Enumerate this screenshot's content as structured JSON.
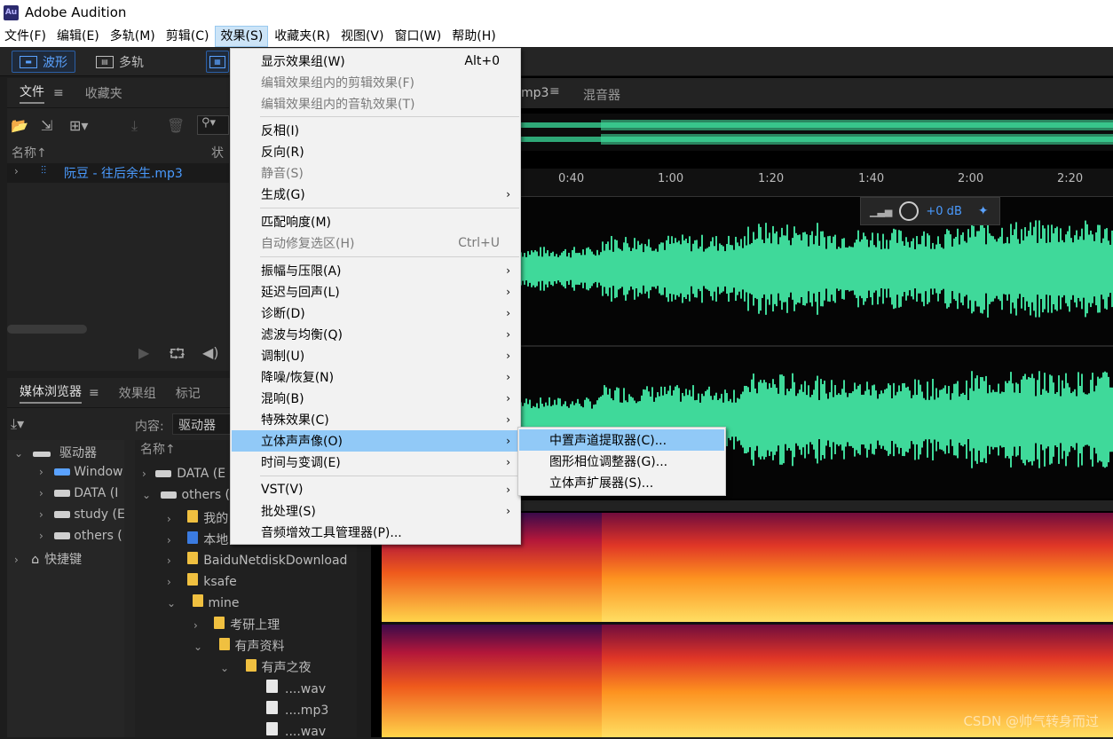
{
  "app": {
    "logo": "Au",
    "title": "Adobe Audition"
  },
  "menubar": [
    "文件(F)",
    "编辑(E)",
    "多轨(M)",
    "剪辑(C)",
    "效果(S)",
    "收藏夹(R)",
    "视图(V)",
    "窗口(W)",
    "帮助(H)"
  ],
  "toolbar": {
    "waveform": "波形",
    "multitrack": "多轨"
  },
  "files_panel": {
    "tabs": [
      "文件",
      "收藏夹"
    ],
    "col_name": "名称",
    "col_status": "状",
    "file": "阮豆 - 往后余生.mp3"
  },
  "media_panel": {
    "tabs": [
      "媒体浏览器",
      "效果组",
      "标记"
    ],
    "content_label": "内容:",
    "content_value": "驱动器",
    "col_name": "名称",
    "left_tree": [
      {
        "label": "驱动器"
      },
      {
        "label": "Window"
      },
      {
        "label": "DATA (I"
      },
      {
        "label": "study (E"
      },
      {
        "label": "others ("
      },
      {
        "label": "快捷键"
      }
    ],
    "right_tree": [
      {
        "label": "DATA (E"
      },
      {
        "label": "others ("
      },
      {
        "label": "我的"
      },
      {
        "label": "本地"
      },
      {
        "label": "BaiduNetdiskDownload"
      },
      {
        "label": "ksafe"
      },
      {
        "label": "mine"
      },
      {
        "label": "考研上理"
      },
      {
        "label": "有声资料"
      },
      {
        "label": "有声之夜"
      },
      {
        "label": "....wav"
      },
      {
        "label": "....mp3"
      },
      {
        "label": "....wav"
      }
    ]
  },
  "editor": {
    "tab_suffix": "mp3",
    "mixer_tab": "混音器",
    "ruler": [
      "0:40",
      "1:00",
      "1:20",
      "1:40",
      "2:00",
      "2:20"
    ],
    "hud_db": "+0 dB"
  },
  "effects_menu": {
    "items": [
      {
        "label": "显示效果组(W)",
        "shortcut": "Alt+0",
        "disabled": false
      },
      {
        "label": "编辑效果组内的剪辑效果(F)",
        "disabled": true
      },
      {
        "label": "编辑效果组内的音轨效果(T)",
        "disabled": true
      },
      {
        "label": "反相(I)"
      },
      {
        "label": "反向(R)"
      },
      {
        "label": "静音(S)",
        "disabled": true
      },
      {
        "label": "生成(G)",
        "submenu": true
      },
      {
        "label": "匹配响度(M)"
      },
      {
        "label": "自动修复选区(H)",
        "shortcut": "Ctrl+U",
        "disabled": true
      },
      {
        "label": "振幅与压限(A)",
        "submenu": true
      },
      {
        "label": "延迟与回声(L)",
        "submenu": true
      },
      {
        "label": "诊断(D)",
        "submenu": true
      },
      {
        "label": "滤波与均衡(Q)",
        "submenu": true
      },
      {
        "label": "调制(U)",
        "submenu": true
      },
      {
        "label": "降噪/恢复(N)",
        "submenu": true
      },
      {
        "label": "混响(B)",
        "submenu": true
      },
      {
        "label": "特殊效果(C)",
        "submenu": true
      },
      {
        "label": "立体声声像(O)",
        "submenu": true,
        "highlighted": true
      },
      {
        "label": "时间与变调(E)",
        "submenu": true
      },
      {
        "label": "VST(V)",
        "submenu": true
      },
      {
        "label": "批处理(S)",
        "submenu": true
      },
      {
        "label": "音频增效工具管理器(P)..."
      }
    ]
  },
  "stereo_submenu": [
    "中置声道提取器(C)...",
    "图形相位调整器(G)...",
    "立体声扩展器(S)..."
  ],
  "watermark": "CSDN @帅气转身而过",
  "colors": {
    "waveform": "#3fd99a",
    "menu_highlight": "#91c9f7",
    "accent_blue": "#4a9bff"
  }
}
